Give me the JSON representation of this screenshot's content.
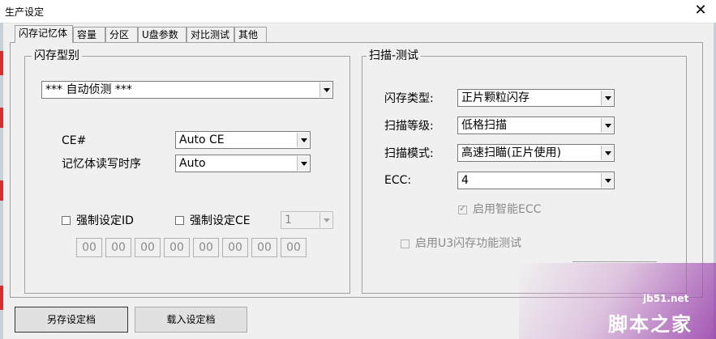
{
  "window": {
    "title": "生产设定",
    "close_label": "✕"
  },
  "tabs": [
    {
      "label": "闪存记忆体",
      "active": true
    },
    {
      "label": "容量"
    },
    {
      "label": "分区"
    },
    {
      "label": "U盘参数"
    },
    {
      "label": "对比测试"
    },
    {
      "label": "其他"
    }
  ],
  "flash_type_group": {
    "title": "闪存型别",
    "detect_select": "*** 自动侦测 ***",
    "ce_label": "CE#",
    "ce_select": "Auto CE",
    "timing_label": "记忆体读写时序",
    "timing_select": "Auto",
    "force_id_label": "强制设定ID",
    "force_ce_label": "强制设定CE",
    "force_ce_select": "1",
    "id_bytes": [
      "00",
      "00",
      "00",
      "00",
      "00",
      "00",
      "00",
      "00"
    ]
  },
  "scan_group": {
    "title": "扫描-测试",
    "flash_kind_label": "闪存类型:",
    "flash_kind_select": "正片颗粒闪存",
    "scan_level_label": "扫描等级:",
    "scan_level_select": "低格扫描",
    "scan_mode_label": "扫描模式:",
    "scan_mode_select": "高速扫瞄(正片使用)",
    "ecc_label": "ECC:",
    "ecc_select": "4",
    "smart_ecc_label": "启用智能ECC",
    "u3_test_label": "启用U3闪存功能测试"
  },
  "footer": {
    "save_button": "另存设定档",
    "load_button": "载入设定档"
  },
  "watermark": {
    "url": "jb51.net",
    "logo": "脚本之家"
  }
}
